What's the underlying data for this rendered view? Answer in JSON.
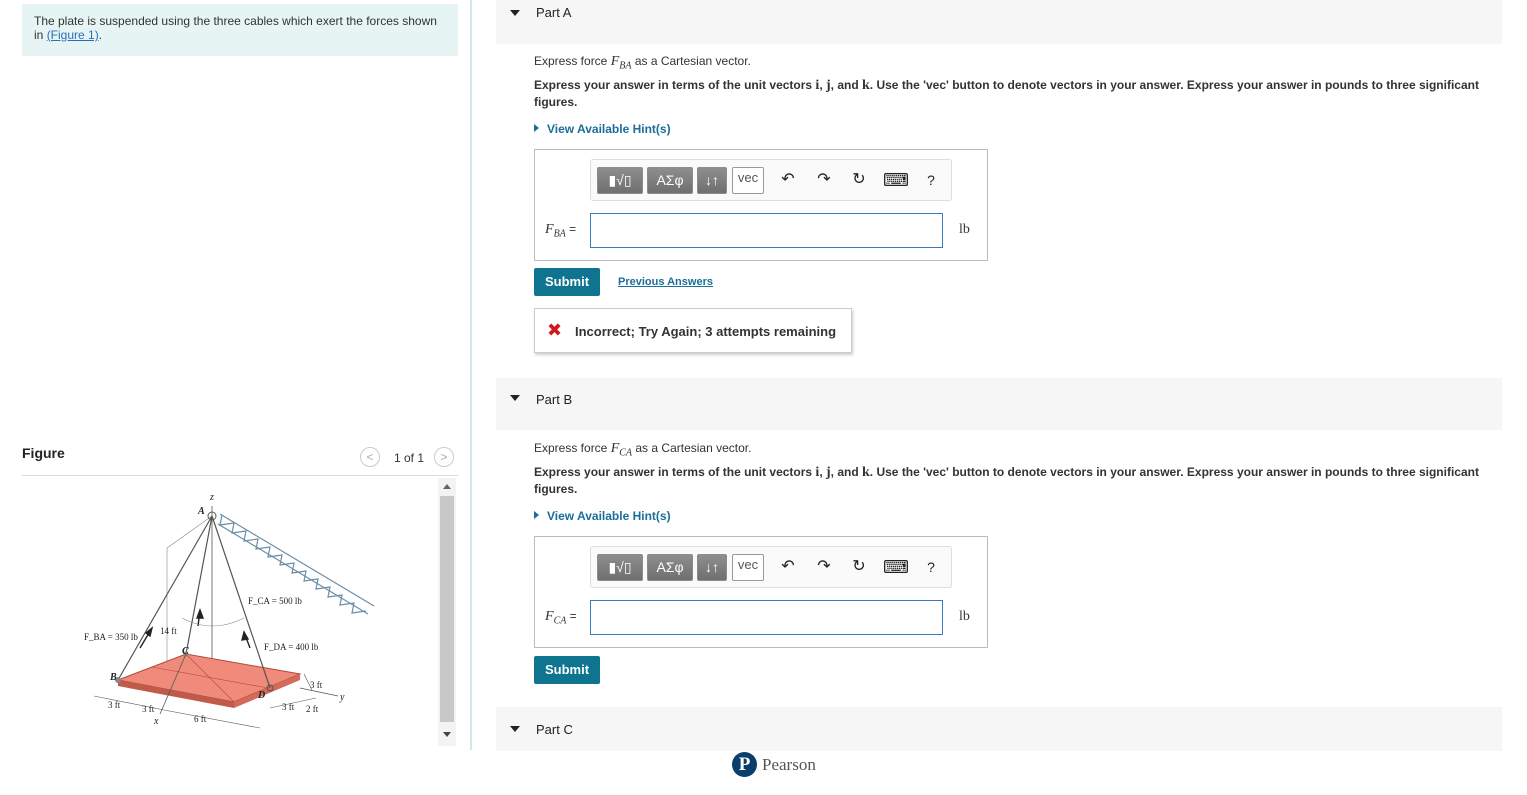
{
  "problem": {
    "text": "The plate is suspended using the three cables which exert the forces shown in ",
    "link": "(Figure 1)",
    "after": "."
  },
  "figure": {
    "title": "Figure",
    "pager": "1 of 1",
    "labels": {
      "z": "z",
      "y": "y",
      "x": "x",
      "A": "A",
      "B": "B",
      "C": "C",
      "D": "D",
      "fca": "F_CA = 500 lb",
      "fba": "F_BA = 350 lb",
      "fda": "F_DA = 400 lb",
      "h14": "14 ft",
      "d3a": "3 ft",
      "d3b": "3 ft",
      "d6": "6 ft",
      "d3c": "3 ft",
      "d3d": "3 ft",
      "d2": "2 ft"
    }
  },
  "partA": {
    "title": "Part A",
    "question_pre": "Express force ",
    "force_symbol": "F",
    "force_sub": "BA",
    "question_post": " as a Cartesian vector.",
    "instruction_pre": "Express your answer in terms of the unit vectors ",
    "vec_i": "i",
    "vec_j": "j",
    "vec_k": "k",
    "instruction_mid": ", and ",
    "instruction_post": ". Use the 'vec' button to denote vectors in your answer. Express your answer in pounds to three significant figures.",
    "hint": "View Available Hint(s)",
    "answer_label_sub": "BA",
    "answer_value": "",
    "unit": "lb",
    "submit": "Submit",
    "previous_answers": "Previous Answers",
    "feedback": "Incorrect; Try Again; 3 attempts remaining"
  },
  "partB": {
    "title": "Part B",
    "question_pre": "Express force ",
    "force_symbol": "F",
    "force_sub": "CA",
    "question_post": " as a Cartesian vector.",
    "instruction_pre": "Express your answer in terms of the unit vectors ",
    "vec_i": "i",
    "vec_j": "j",
    "vec_k": "k",
    "instruction_mid": ", and ",
    "instruction_post": ". Use the 'vec' button to denote vectors in your answer. Express your answer in pounds to three significant figures.",
    "hint": "View Available Hint(s)",
    "answer_label_sub": "CA",
    "answer_value": "",
    "unit": "lb",
    "submit": "Submit"
  },
  "partC": {
    "title": "Part C"
  },
  "toolbar": {
    "templates": "▮√▯",
    "greek": "ΑΣφ",
    "arrows": "↓↑",
    "vec": "vec",
    "undo": "↶",
    "redo": "↷",
    "reset": "↻",
    "keyboard": "⌨",
    "help": "?"
  },
  "footer": {
    "brand": "Pearson",
    "logo_letter": "P"
  },
  "colors": {
    "accent": "#0e7490",
    "link": "#1a6e9a",
    "error": "#d0191f",
    "plate": "#f08a7a"
  }
}
